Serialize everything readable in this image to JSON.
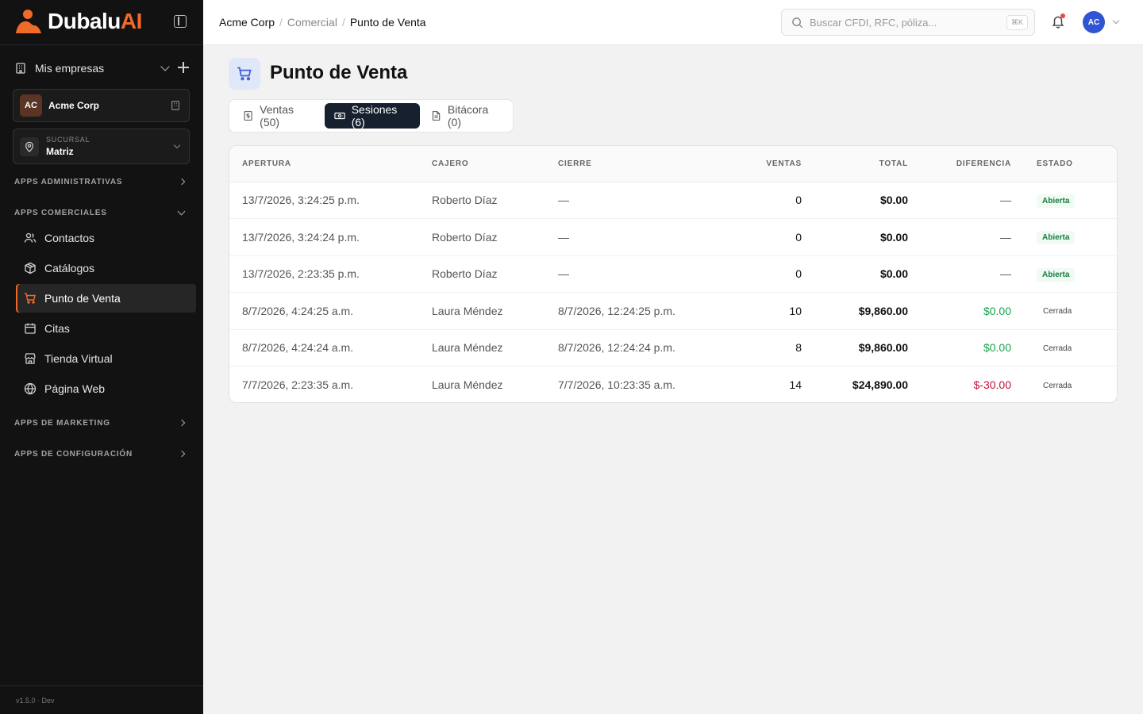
{
  "brand": {
    "name_main": "Dubalu",
    "name_accent": "AI"
  },
  "sidebar": {
    "companies_label": "Mis empresas",
    "company": {
      "initials": "AC",
      "name": "Acme Corp"
    },
    "branch": {
      "label": "SUCURSAL",
      "value": "Matriz"
    },
    "sections": {
      "admin": "APPS ADMINISTRATIVAS",
      "commercial": "APPS COMERCIALES",
      "marketing": "APPS DE MARKETING",
      "config": "APPS DE CONFIGURACIÓN"
    },
    "items": [
      {
        "label": "Contactos",
        "icon": "users-icon"
      },
      {
        "label": "Catálogos",
        "icon": "box-icon"
      },
      {
        "label": "Punto de Venta",
        "icon": "cart-icon",
        "active": true
      },
      {
        "label": "Citas",
        "icon": "calendar-icon"
      },
      {
        "label": "Tienda Virtual",
        "icon": "store-icon"
      },
      {
        "label": "Página Web",
        "icon": "globe-icon"
      }
    ],
    "version": "v1.5.0 · Dev"
  },
  "topbar": {
    "breadcrumb": [
      "Acme Corp",
      "Comercial",
      "Punto de Venta"
    ],
    "search_placeholder": "Buscar CFDI, RFC, póliza...",
    "search_shortcut": "⌘K",
    "user_initials": "AC"
  },
  "page": {
    "title": "Punto de Venta",
    "tabs": [
      {
        "label": "Ventas (50)",
        "icon": "dollar-doc-icon"
      },
      {
        "label": "Sesiones (6)",
        "icon": "cash-icon",
        "active": true
      },
      {
        "label": "Bitácora (0)",
        "icon": "doc-icon"
      }
    ]
  },
  "table": {
    "headers": [
      "APERTURA",
      "CAJERO",
      "CIERRE",
      "VENTAS",
      "TOTAL",
      "DIFERENCIA",
      "ESTADO"
    ],
    "rows": [
      {
        "apertura": "13/7/2026, 3:24:25 p.m.",
        "cajero": "Roberto Díaz",
        "cierre": "—",
        "ventas": "0",
        "total": "$0.00",
        "diferencia": "—",
        "estado": "Abierta"
      },
      {
        "apertura": "13/7/2026, 3:24:24 p.m.",
        "cajero": "Roberto Díaz",
        "cierre": "—",
        "ventas": "0",
        "total": "$0.00",
        "diferencia": "—",
        "estado": "Abierta"
      },
      {
        "apertura": "13/7/2026, 2:23:35 p.m.",
        "cajero": "Roberto Díaz",
        "cierre": "—",
        "ventas": "0",
        "total": "$0.00",
        "diferencia": "—",
        "estado": "Abierta"
      },
      {
        "apertura": "8/7/2026, 4:24:25 a.m.",
        "cajero": "Laura Méndez",
        "cierre": "8/7/2026, 12:24:25 p.m.",
        "ventas": "10",
        "total": "$9,860.00",
        "diferencia": "$0.00",
        "estado": "Cerrada"
      },
      {
        "apertura": "8/7/2026, 4:24:24 a.m.",
        "cajero": "Laura Méndez",
        "cierre": "8/7/2026, 12:24:24 p.m.",
        "ventas": "8",
        "total": "$9,860.00",
        "diferencia": "$0.00",
        "estado": "Cerrada"
      },
      {
        "apertura": "7/7/2026, 2:23:35 a.m.",
        "cajero": "Laura Méndez",
        "cierre": "7/7/2026, 10:23:35 a.m.",
        "ventas": "14",
        "total": "$24,890.00",
        "diferencia": "$-30.00",
        "estado": "Cerrada"
      }
    ]
  },
  "colors": {
    "accent": "#f06a2a",
    "sidebar_bg": "#121212",
    "tab_active": "#17202e",
    "avatar": "#2f55d4",
    "positive": "#16a34a",
    "negative": "#be123c"
  }
}
